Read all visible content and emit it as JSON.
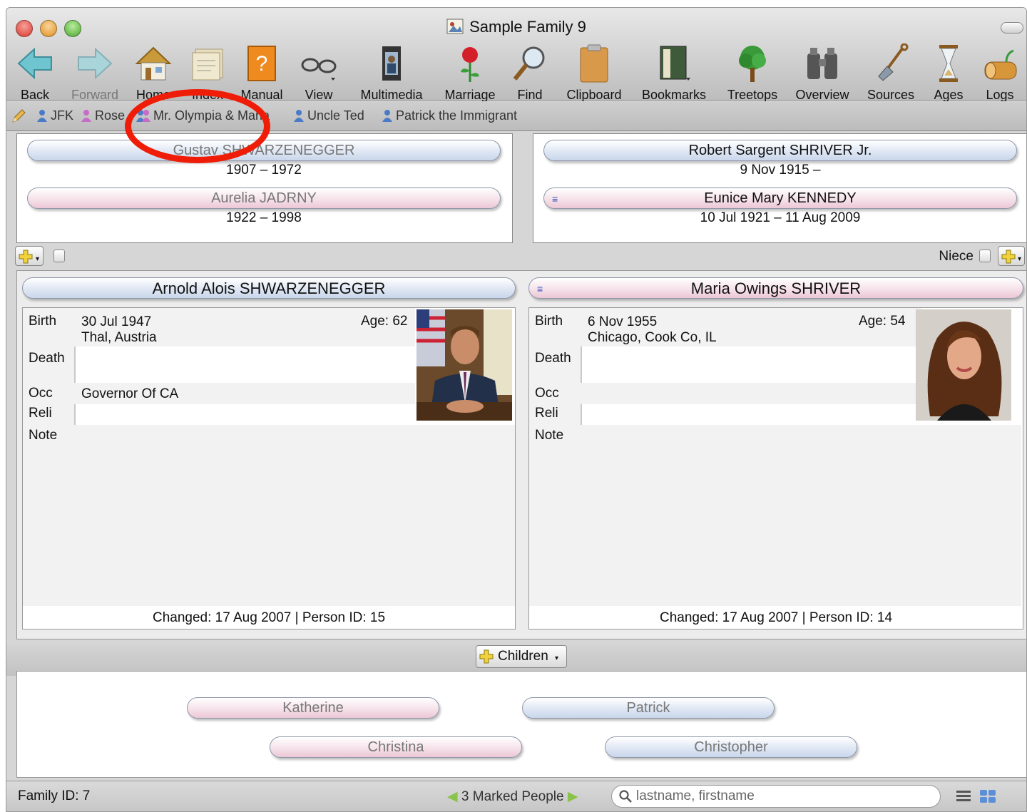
{
  "window": {
    "title": "Sample Family 9",
    "traffic_light_colors": [
      "#e2463c",
      "#e8a13a",
      "#5fb942"
    ]
  },
  "toolbar": {
    "items": [
      {
        "label": "Back",
        "icon": "back-arrow-icon"
      },
      {
        "label": "Forward",
        "icon": "forward-arrow-icon"
      },
      {
        "label": "Home",
        "icon": "home-icon"
      },
      {
        "label": "Index",
        "icon": "index-cards-icon"
      },
      {
        "label": "Manual",
        "icon": "manual-book-icon"
      },
      {
        "label": "View",
        "icon": "glasses-icon"
      },
      {
        "label": "Multimedia",
        "icon": "filmstrip-icon"
      },
      {
        "label": "Marriage",
        "icon": "rose-icon"
      },
      {
        "label": "Find",
        "icon": "magnifier-icon"
      },
      {
        "label": "Clipboard",
        "icon": "clipboard-icon"
      },
      {
        "label": "Bookmarks",
        "icon": "bookmarks-book-icon"
      },
      {
        "label": "Treetops",
        "icon": "tree-icon"
      },
      {
        "label": "Overview",
        "icon": "binoculars-icon"
      },
      {
        "label": "Sources",
        "icon": "shovel-icon"
      },
      {
        "label": "Ages",
        "icon": "hourglass-icon"
      },
      {
        "label": "Logs",
        "icon": "logs-icon"
      }
    ]
  },
  "bookmarks": [
    "JFK",
    "Rose",
    "Mr. Olympia & Maria",
    "Uncle Ted",
    "Patrick the Immigrant"
  ],
  "parents_left": {
    "father": {
      "name": "Gustav SHWARZENEGGER",
      "dates": "1907 – 1972"
    },
    "mother": {
      "name": "Aurelia JADRNY",
      "dates": "1922 – 1998"
    }
  },
  "parents_right": {
    "father": {
      "name": "Robert Sargent SHRIVER Jr.",
      "dates": "9 Nov 1915 –"
    },
    "mother": {
      "name": "Eunice Mary KENNEDY",
      "dates": "10 Jul 1921 – 11 Aug 2009"
    }
  },
  "relation_label": "Niece",
  "husband": {
    "name": "Arnold Alois SHWARZENEGGER",
    "birth_label": "Birth",
    "birth_date": "30 Jul 1947",
    "birth_place": "Thal, Austria",
    "age": "Age: 62",
    "death_label": "Death",
    "death": "",
    "occ_label": "Occ",
    "occ": "Governor Of CA",
    "reli_label": "Reli",
    "reli": "",
    "note_label": "Note",
    "changed": "Changed: 17 Aug 2007 | Person ID: 15"
  },
  "wife": {
    "name": "Maria Owings SHRIVER",
    "birth_label": "Birth",
    "birth_date": "6 Nov 1955",
    "birth_place": "Chicago, Cook Co, IL",
    "age": "Age: 54",
    "death_label": "Death",
    "death": "",
    "occ_label": "Occ",
    "occ": "",
    "reli_label": "Reli",
    "reli": "",
    "note_label": "Note",
    "changed": "Changed: 17 Aug 2007 | Person ID: 14"
  },
  "children_button": "Children",
  "children": [
    {
      "name": "Katherine"
    },
    {
      "name": "Patrick"
    },
    {
      "name": "Christina"
    },
    {
      "name": "Christopher"
    }
  ],
  "status": {
    "family_id": "Family ID: 7",
    "marked": "3 Marked People",
    "search_placeholder": "lastname, firstname"
  },
  "colors": {
    "male_button": "#dfe7f4",
    "female_button": "#f6e2ea",
    "annotation_circle": "#ef1d08"
  }
}
